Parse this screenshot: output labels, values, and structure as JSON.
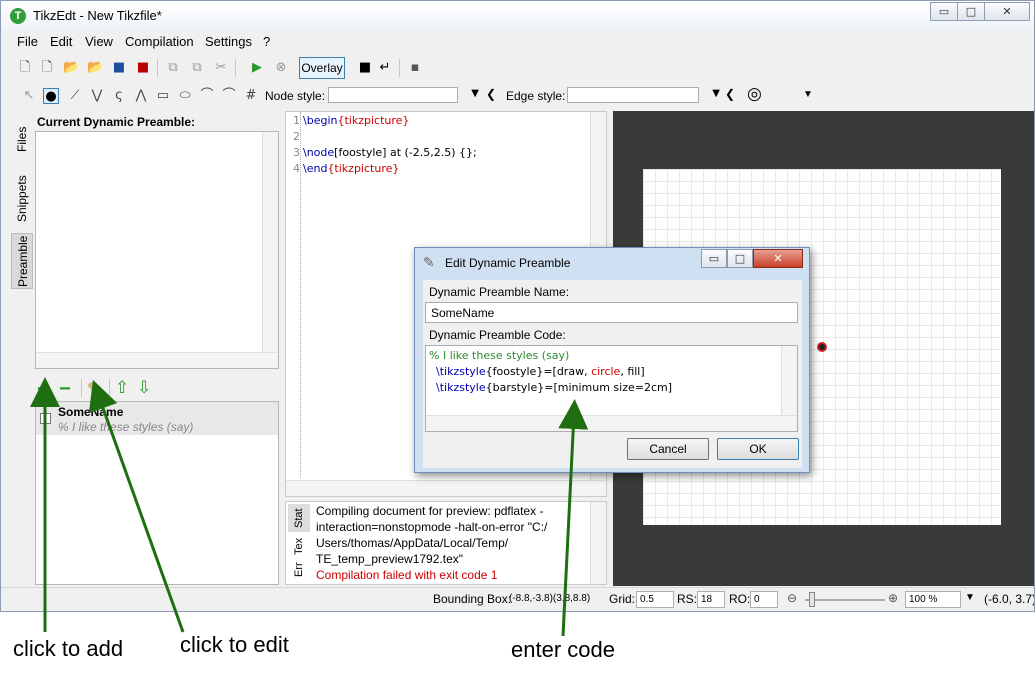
{
  "window": {
    "title": "TikzEdt - New Tikzfile*",
    "logo_letter": "T",
    "minimize": "▭",
    "maximize": "□",
    "close": "✕"
  },
  "menu": [
    "File",
    "Edit",
    "View",
    "Compilation",
    "Settings",
    "?"
  ],
  "toolbar": {
    "overlay_label": "Overlay"
  },
  "toolbar2": {
    "node_style_label": "Node style:",
    "edge_style_label": "Edge style:",
    "node_style_value": "",
    "edge_style_value": ""
  },
  "sidetabs": [
    "Files",
    "Snippets",
    "Preamble"
  ],
  "preamble_panel": {
    "title": "Current Dynamic Preamble:",
    "items": [
      {
        "name": "SomeName",
        "comment": "% I like these styles (say)"
      }
    ]
  },
  "editor": {
    "line_numbers": [
      "1",
      "2",
      "3",
      "4"
    ],
    "line1": {
      "kw": "\\begin",
      "arg": "{tikzpicture}"
    },
    "line3": {
      "kw": "\\node",
      "rest": "[foostyle] at (-2.5,2.5) {};"
    },
    "line4": {
      "kw": "\\end",
      "arg": "{tikzpicture}"
    }
  },
  "output": {
    "tabs": [
      "Stat",
      "Tex",
      "Err"
    ],
    "lines": [
      "Compiling document for preview: pdflatex -",
      "interaction=nonstopmode -halt-on-error \"C:/",
      "Users/thomas/AppData/Local/Temp/",
      "TE_temp_preview1792.tex\""
    ],
    "error": "Compilation failed with exit code 1"
  },
  "statusbar": {
    "bbox_label": "Bounding Box:",
    "bbox_value": "(-8.8,-3.8)(3.8,8.8)",
    "grid_label": "Grid:",
    "grid_value": "0.5",
    "rs_label": "RS:",
    "rs_value": "18",
    "ro_label": "RO:",
    "ro_value": "0",
    "zoom_value": "100 %",
    "coords": "(-6.0, 3.7)"
  },
  "dialog": {
    "title": "Edit Dynamic Preamble",
    "name_label": "Dynamic Preamble Name:",
    "name_value": "SomeName",
    "code_label": "Dynamic Preamble Code:",
    "code_comment": "% I like these styles (say)",
    "code_line2": {
      "kw": "\\tikzstyle",
      "a": "{foostyle}=[draw, ",
      "b": "circle",
      "c": ", fill]"
    },
    "code_line3": {
      "kw": "\\tikzstyle",
      "a": "{barstyle}=[minimum size=2cm]"
    },
    "cancel_label": "Cancel",
    "ok_label": "OK"
  },
  "annotations": {
    "add": "click to add",
    "edit": "click to edit",
    "code": "enter code"
  },
  "colors": {
    "arrow": "#1f6e12",
    "accent": "#3c7fb1",
    "error": "#cc0000"
  }
}
